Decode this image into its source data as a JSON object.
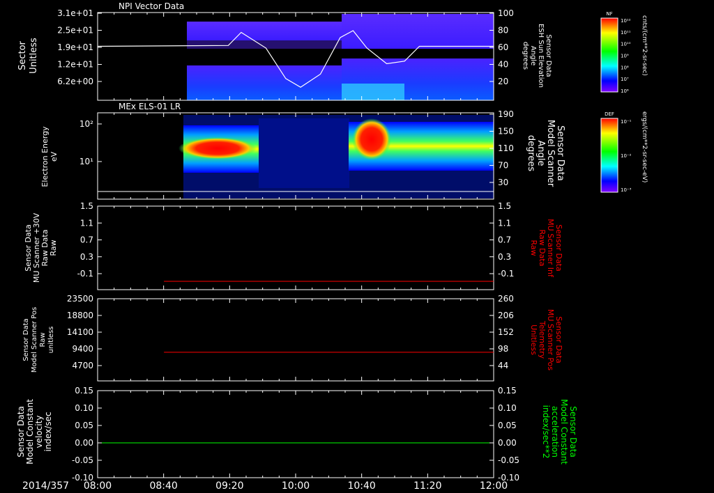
{
  "colors": {
    "background": "#000000",
    "axes": "#ffffff",
    "red_trace": "#ff0000",
    "green_trace": "#00ff00",
    "colorbar": [
      "#ff0000",
      "#ffff00",
      "#00ff00",
      "#00ffff",
      "#0000ff",
      "#8000ff"
    ]
  },
  "time_axis": {
    "date_label": "2014/357",
    "ticks": [
      "08:00",
      "08:40",
      "09:20",
      "10:00",
      "10:40",
      "11:20",
      "12:00"
    ]
  },
  "chart_data": [
    {
      "type": "heatmap",
      "title": "NPI Vector Data",
      "ylabel": [
        "Sector",
        "Unitless"
      ],
      "y_ticks": [
        "3.1e+01",
        "2.5e+01",
        "1.9e+01",
        "1.2e+01",
        "6.2e+00"
      ],
      "y2label": [
        "Sensor Data",
        "ESH Sun Elevation",
        "Angle",
        "degrees"
      ],
      "y2_ticks": [
        "100",
        "80",
        "60",
        "40",
        "20"
      ],
      "overlay_line": {
        "t_hours": [
          8.0,
          9.32,
          9.45,
          9.7,
          9.9,
          10.05,
          10.25,
          10.45,
          10.58,
          10.72,
          10.92,
          11.1,
          11.25,
          12.0
        ],
        "angle_deg": [
          62,
          63,
          78,
          60,
          25,
          15,
          30,
          72,
          80,
          60,
          42,
          45,
          62,
          62
        ]
      },
      "colorbar": {
        "label": "NF",
        "units": "cnts/(cm**2-sr-sec)",
        "ticks": [
          "10¹²",
          "10¹¹",
          "10¹⁰",
          "10⁹",
          "10⁸",
          "10⁷",
          "10⁶"
        ]
      }
    },
    {
      "type": "heatmap",
      "title": "MEx ELS-01 LR",
      "ylabel": [
        "Electron Energy",
        "eV"
      ],
      "y_ticks": [
        "10²",
        "10¹"
      ],
      "y2label": [
        "Sensor Data",
        "Model Scanner",
        "Angle",
        "degrees"
      ],
      "y2_ticks": [
        "190",
        "150",
        "110",
        "70",
        "30"
      ],
      "colorbar": {
        "label": "DEF",
        "units": "ergs/(cm**2-sr-sec-eV)",
        "ticks": [
          "10⁻¹",
          "10⁻²",
          "10⁻³"
        ]
      }
    },
    {
      "type": "line",
      "ylabel": [
        "Sensor Data",
        "MU Scanner +30V",
        "Raw Data",
        "Raw"
      ],
      "y_ticks": [
        "1.5",
        "1.1",
        "0.7",
        "0.3",
        "-0.1"
      ],
      "y2label": [
        "Sensor Data",
        "MU Scanner Inf",
        "Raw Data",
        "Raw"
      ],
      "y2_ticks": [
        "1.5",
        "1.1",
        "0.7",
        "0.3",
        "-0.1"
      ],
      "ylim": [
        -0.3,
        1.5
      ],
      "series": [
        {
          "t_hours": [
            8.67,
            12.0
          ],
          "values": [
            -0.12,
            -0.12
          ]
        }
      ]
    },
    {
      "type": "line",
      "ylabel": [
        "Sensor Data",
        "Model Scanner Pos",
        "Raw",
        "unitless"
      ],
      "y_ticks": [
        "23500",
        "18800",
        "14100",
        "9400",
        "4700"
      ],
      "y2label": [
        "Sensor Data",
        "MU Scanner Pos",
        "Telemetry",
        "Unitless"
      ],
      "y2_ticks": [
        "260",
        "206",
        "152",
        "98",
        "44"
      ],
      "ylim": [
        0,
        23500
      ],
      "series": [
        {
          "t_hours": [
            8.67,
            12.0
          ],
          "values": [
            8200,
            8200
          ]
        }
      ]
    },
    {
      "type": "line",
      "ylabel": [
        "Sensor Data",
        "Model Constant",
        "velocity",
        "index/sec"
      ],
      "y_ticks": [
        "0.15",
        "0.10",
        "0.05",
        "0.00",
        "-0.05",
        "-0.10"
      ],
      "y2label": [
        "Sensor Data",
        "Model Constant",
        "acceleration",
        "index/sec**2"
      ],
      "y2_ticks": [
        "0.15",
        "0.10",
        "0.05",
        "0.00",
        "-0.05",
        "-0.10"
      ],
      "ylim": [
        -0.1,
        0.15
      ],
      "series": [
        {
          "t_hours": [
            8.0,
            12.0
          ],
          "values": [
            0.0,
            0.0
          ]
        }
      ]
    }
  ]
}
